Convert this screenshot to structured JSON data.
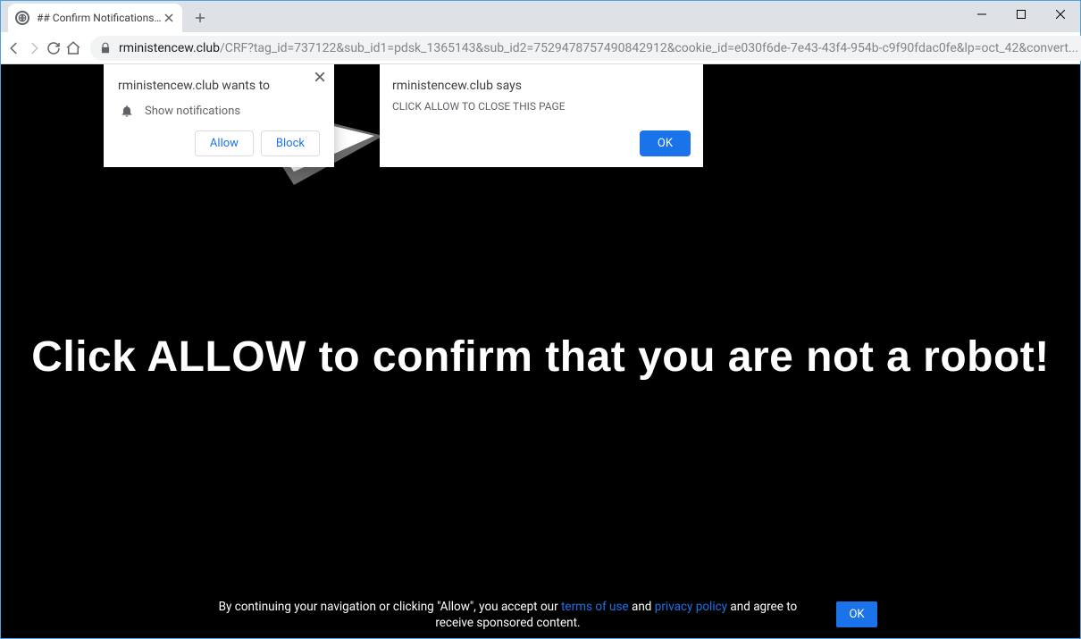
{
  "window": {
    "minimize": "–",
    "maximize": "☐",
    "close": "✕"
  },
  "tab": {
    "title": "## Confirm Notifications ##"
  },
  "address": {
    "host": "rministencew.club",
    "path": "/CRF?tag_id=737122&sub_id1=pdsk_1365143&sub_id2=7529478757490842912&cookie_id=e030f6de-7e43-43f4-954b-c9f90fdac0fe&lp=oct_42&convert..."
  },
  "permission": {
    "title": "rministencew.club wants to",
    "item": "Show notifications",
    "allow": "Allow",
    "block": "Block"
  },
  "jsalert": {
    "title": "rministencew.club says",
    "message": "CLICK ALLOW TO CLOSE THIS PAGE",
    "ok": "OK"
  },
  "page": {
    "headline": "Click ALLOW to confirm that you are not a robot!"
  },
  "footer": {
    "pre": "By continuing your navigation or clicking \"Allow\", you accept our ",
    "terms": "terms of use",
    "and": " and ",
    "privacy": "privacy policy",
    "post": " and agree to receive sponsored content.",
    "ok": "OK"
  }
}
